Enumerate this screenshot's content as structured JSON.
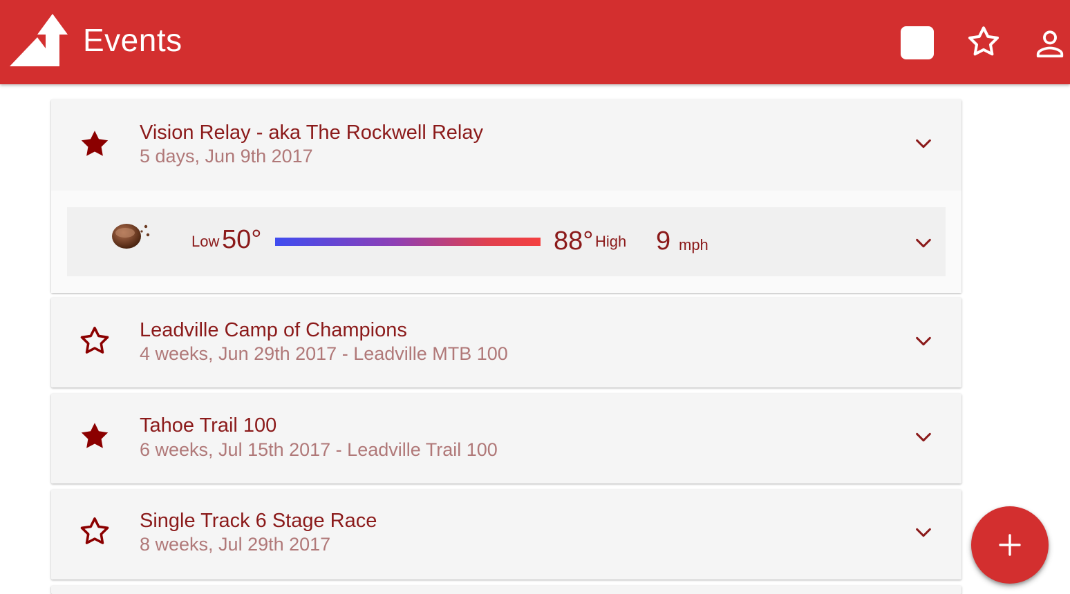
{
  "app": {
    "title": "Events"
  },
  "colors": {
    "primary": "#d32f2f",
    "text_primary": "#8b1a1a",
    "text_secondary": "#b07878",
    "card_bg": "#f5f5f5"
  },
  "header": {
    "icons": [
      "square-icon",
      "star-outline-icon",
      "account-icon"
    ]
  },
  "events": [
    {
      "title": "Vision Relay - aka The Rockwell Relay",
      "subtitle": "5 days, Jun 9th 2017",
      "favorite": true,
      "expanded": true
    },
    {
      "title": "Leadville Camp of Champions",
      "subtitle": "4 weeks, Jun 29th 2017 - Leadville MTB 100",
      "favorite": false,
      "expanded": false
    },
    {
      "title": "Tahoe Trail 100",
      "subtitle": "6 weeks, Jul 15th 2017 - Leadville Trail 100",
      "favorite": true,
      "expanded": false
    },
    {
      "title": "Single Track 6 Stage Race",
      "subtitle": "8 weeks, Jul 29th 2017",
      "favorite": false,
      "expanded": false
    }
  ],
  "weather": {
    "icon": "night-cloudy-icon",
    "low_label": "Low",
    "low_value": "50°",
    "high_value": "88°",
    "high_label": "High",
    "wind_value": "9",
    "wind_unit": "mph"
  },
  "fab": {
    "icon": "plus-icon"
  }
}
